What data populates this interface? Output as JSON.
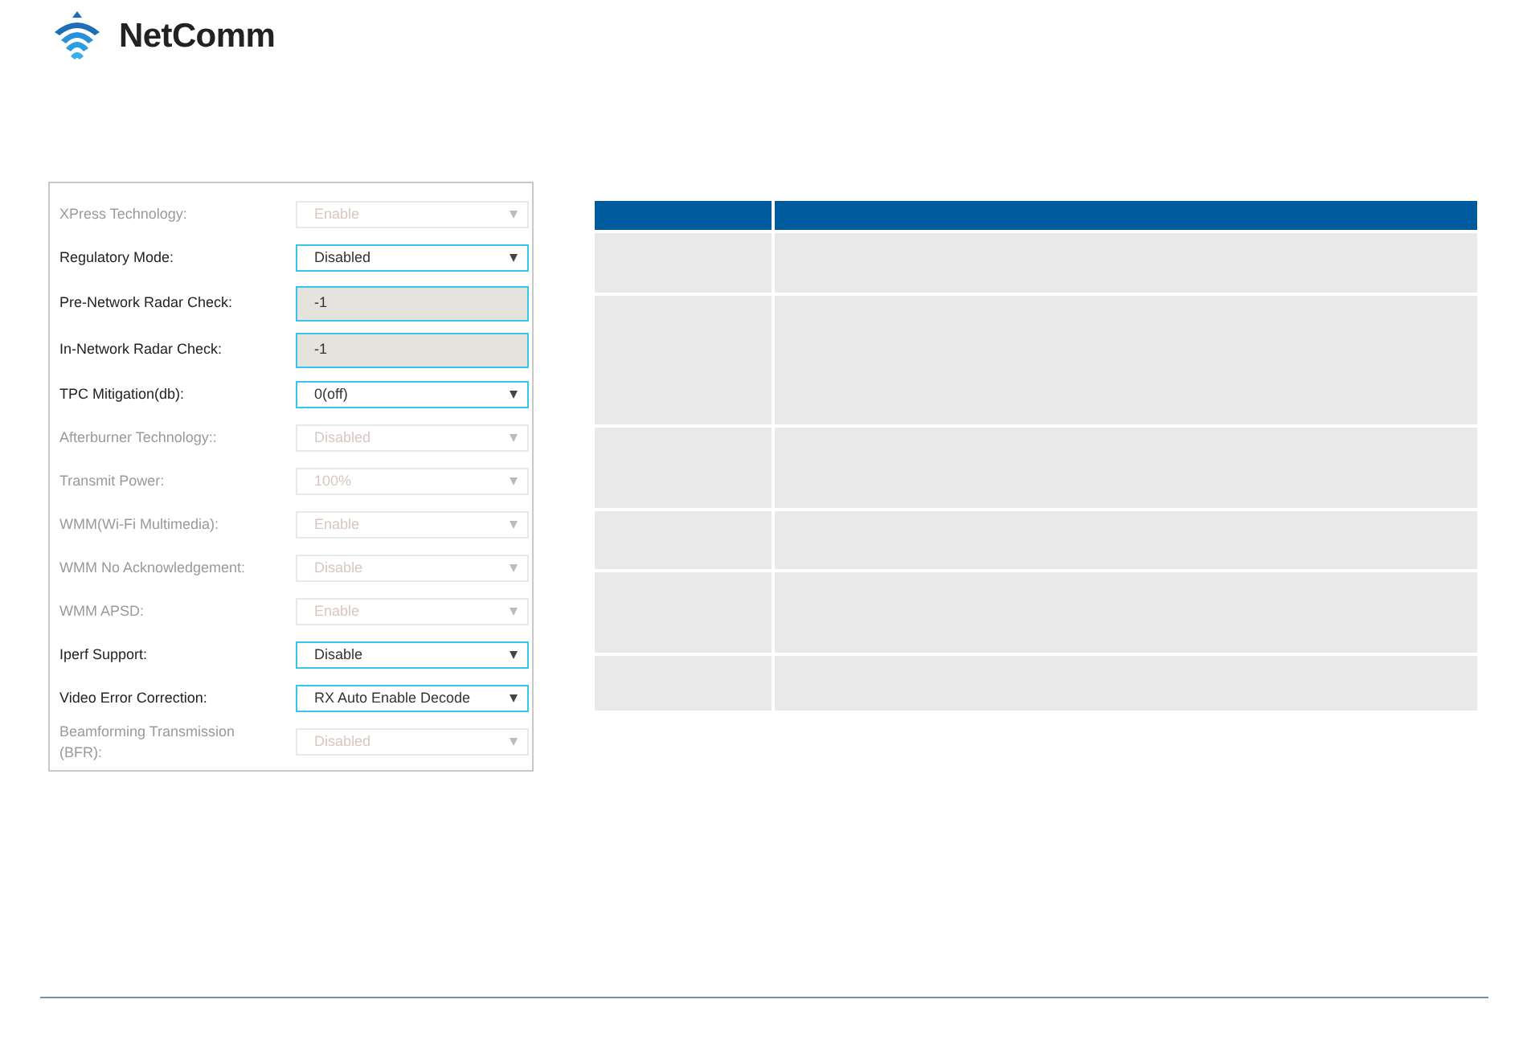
{
  "logo": {
    "text": "NetComm"
  },
  "settings": [
    {
      "label": "XPress Technology:",
      "kind": "select",
      "value": "Enable",
      "disabled": true
    },
    {
      "label": "Regulatory Mode:",
      "kind": "select",
      "value": "Disabled",
      "disabled": false
    },
    {
      "label": "Pre-Network Radar Check:",
      "kind": "text",
      "value": "-1",
      "disabled": false
    },
    {
      "label": "In-Network Radar Check:",
      "kind": "text",
      "value": "-1",
      "disabled": false
    },
    {
      "label": "TPC Mitigation(db):",
      "kind": "select",
      "value": "0(off)",
      "disabled": false
    },
    {
      "label": "Afterburner Technology::",
      "kind": "select",
      "value": "Disabled",
      "disabled": true
    },
    {
      "label": "Transmit Power:",
      "kind": "select",
      "value": "100%",
      "disabled": true
    },
    {
      "label": "WMM(Wi-Fi Multimedia):",
      "kind": "select",
      "value": "Enable",
      "disabled": true
    },
    {
      "label": "WMM No Acknowledgement:",
      "kind": "select",
      "value": "Disable",
      "disabled": true
    },
    {
      "label": "WMM APSD:",
      "kind": "select",
      "value": "Enable",
      "disabled": true
    },
    {
      "label": "Iperf Support:",
      "kind": "select",
      "value": "Disable",
      "disabled": false
    },
    {
      "label": "Video Error Correction:",
      "kind": "select",
      "value": "RX Auto Enable Decode",
      "disabled": false
    },
    {
      "label": "Beamforming Transmission (BFR):",
      "kind": "select",
      "value": "Disabled",
      "disabled": true
    }
  ]
}
